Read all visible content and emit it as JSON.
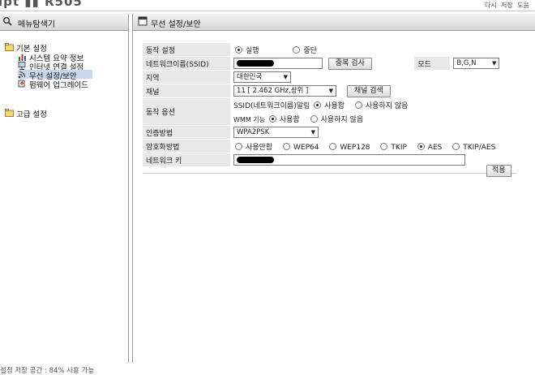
{
  "topbar": {
    "logo": "ipt ▮▮ R505",
    "links": [
      "다시",
      "저장",
      "도움"
    ]
  },
  "left": {
    "title": "메뉴탐색기",
    "groups": [
      {
        "label": "기본 설정",
        "items": [
          "시스템 요약 정보",
          "인터넷 연결 설정",
          "무선 설정/보안",
          "펌웨어 업그레이드"
        ]
      },
      {
        "label": "고급 설정"
      }
    ],
    "storage": "설정 저장 공간 : 84% 사용 가능"
  },
  "right": {
    "title": "무선 설정/보안",
    "form": {
      "operation": {
        "label": "동작 설정",
        "options": [
          "실행",
          "중단"
        ],
        "selected": "실행"
      },
      "ssid": {
        "label": "네트워크이름(SSID)",
        "value": "",
        "search_btn": "중복 검사",
        "mode_label": "모드",
        "mode_value": "B,G,N"
      },
      "region": {
        "label": "지역",
        "value": "대한민국"
      },
      "channel": {
        "label": "채널",
        "value": "11 [ 2.462 GHz,상위 ]",
        "search_btn": "채널 검색"
      },
      "options": {
        "label": "동작 옵션",
        "ssid_broadcast": {
          "label": "SSID(네트워크이름)알림",
          "on": "사용함",
          "off": "사용하지 않음",
          "selected": "on"
        },
        "wmm": {
          "label": "WMM 기능",
          "on": "사용함",
          "off": "사용하지 않음",
          "selected": "on"
        }
      },
      "auth": {
        "label": "인증방법",
        "value": "WPA2PSK"
      },
      "encryption": {
        "label": "암호화방법",
        "options": [
          "사용안함",
          "WEP64",
          "WEP128",
          "TKIP",
          "AES",
          "TKIP/AES"
        ],
        "selected": "AES"
      },
      "key": {
        "label": "네트워크 키",
        "value": ""
      }
    },
    "apply": "적용"
  }
}
